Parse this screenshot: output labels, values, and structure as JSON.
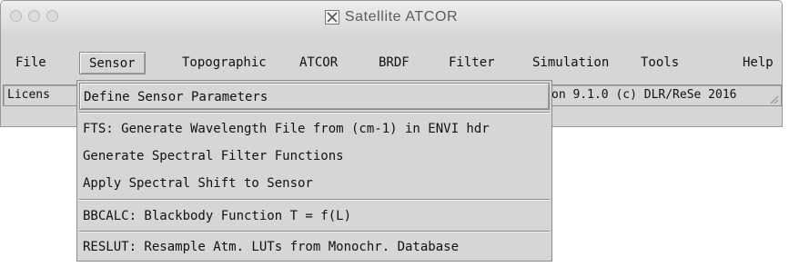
{
  "window": {
    "title": "Satellite ATCOR",
    "app_icon": "x11-icon"
  },
  "menubar": {
    "items": [
      {
        "label": "File"
      },
      {
        "label": "Sensor",
        "active": true
      },
      {
        "label": "Topographic"
      },
      {
        "label": "ATCOR"
      },
      {
        "label": "BRDF"
      },
      {
        "label": "Filter"
      },
      {
        "label": "Simulation"
      },
      {
        "label": "Tools"
      },
      {
        "label": "Help"
      }
    ]
  },
  "status": {
    "license_fragment": "Licens",
    "version_text": "on 9.1.0 (c) DLR/ReSe 2016"
  },
  "dropdown": {
    "items": [
      {
        "label": "Define Sensor Parameters"
      },
      {
        "label": "FTS: Generate Wavelength File from (cm-1) in ENVI hdr"
      },
      {
        "label": "Generate Spectral Filter Functions"
      },
      {
        "label": "Apply Spectral Shift to Sensor"
      },
      {
        "label": "BBCALC: Blackbody Function T = f(L)"
      },
      {
        "label": "RESLUT: Resample Atm. LUTs from Monochr. Database"
      }
    ]
  },
  "colors": {
    "chrome": "#d6d6d6",
    "border": "#8c8c8c",
    "title_text": "#5c5c5c"
  }
}
